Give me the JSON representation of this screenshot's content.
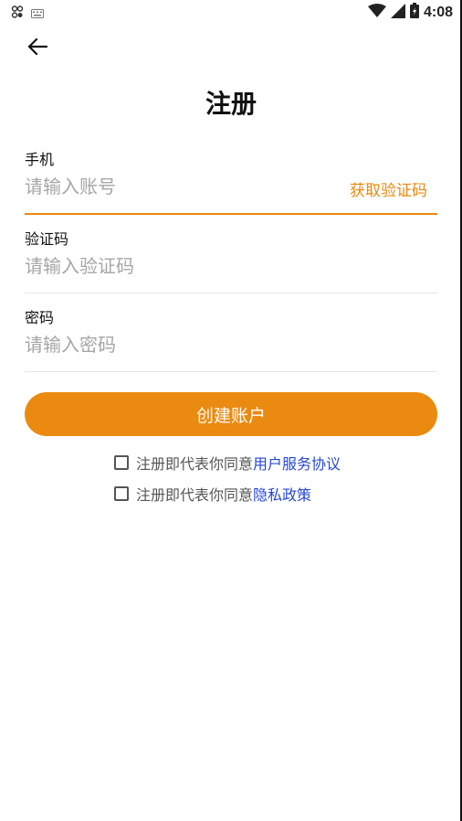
{
  "status_bar": {
    "time": "4:08",
    "icons": [
      "notification-icon",
      "keyboard-icon",
      "wifi-icon",
      "signal-icon",
      "battery-icon"
    ]
  },
  "header": {
    "back_icon": "arrow-left-icon",
    "title": "注册"
  },
  "form": {
    "phone": {
      "label": "手机",
      "placeholder": "请输入账号",
      "value": "",
      "code_button": "获取验证码"
    },
    "code": {
      "label": "验证码",
      "placeholder": "请输入验证码",
      "value": ""
    },
    "password": {
      "label": "密码",
      "placeholder": "请输入密码",
      "value": ""
    },
    "submit_label": "创建账户"
  },
  "agreements": [
    {
      "prefix": "注册即代表你同意",
      "link": "用户服务协议",
      "checked": false
    },
    {
      "prefix": "注册即代表你同意",
      "link": "隐私政策",
      "checked": false
    }
  ],
  "colors": {
    "accent": "#eb8a10",
    "link": "#2747d6",
    "placeholder": "#a6a6a6",
    "divider": "#e6e6e6"
  }
}
